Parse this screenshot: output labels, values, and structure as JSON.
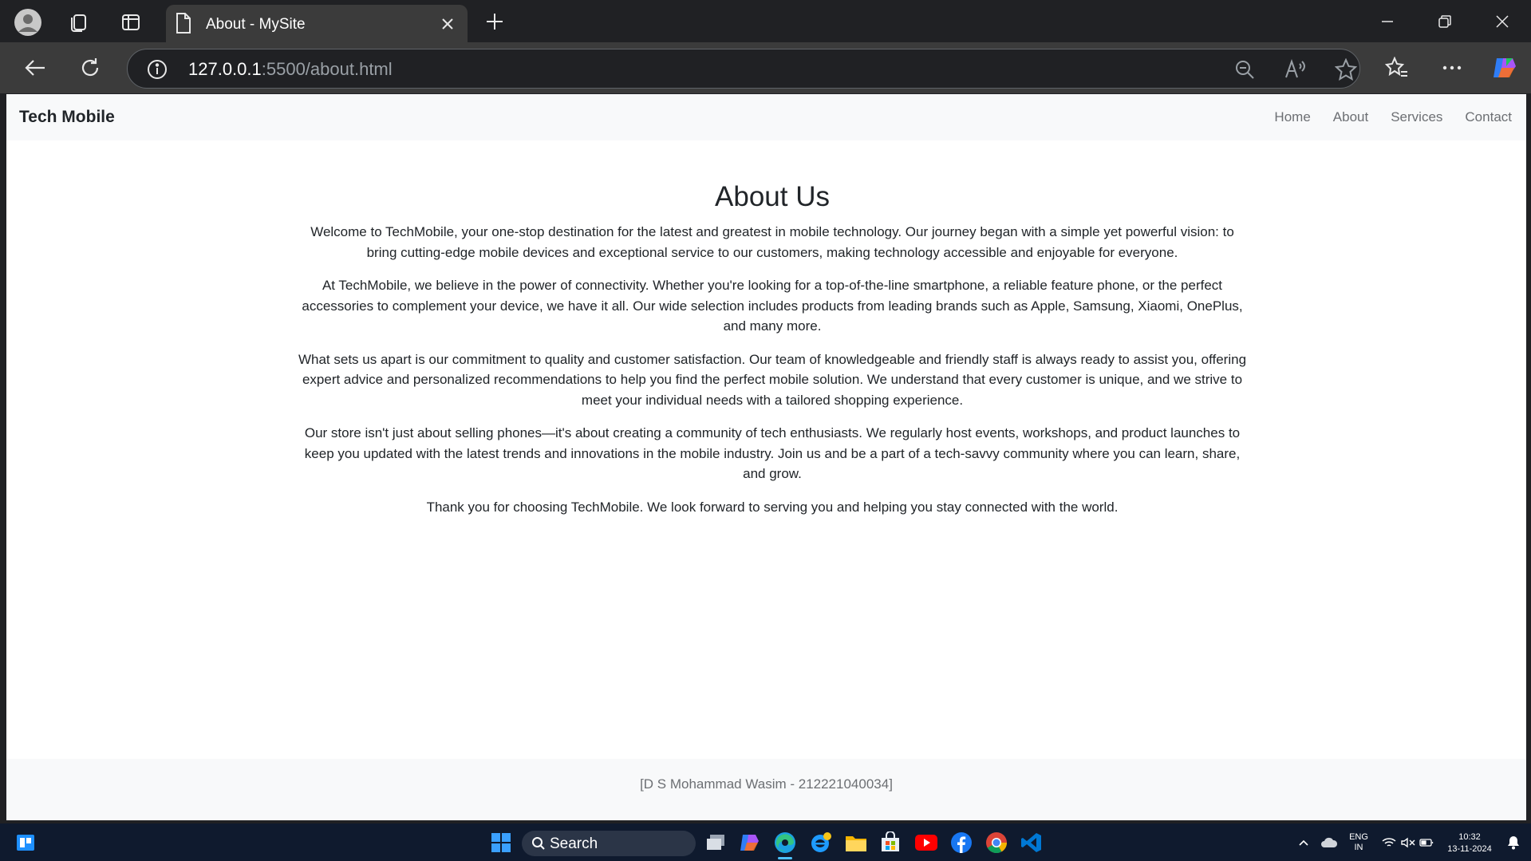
{
  "browser": {
    "tab_title": "About - MySite",
    "url_host": "127.0.0.1",
    "url_rest": ":5500/about.html"
  },
  "site": {
    "brand": "Tech Mobile",
    "nav": [
      "Home",
      "About",
      "Services",
      "Contact"
    ],
    "heading": "About Us",
    "paragraphs": [
      "Welcome to TechMobile, your one-stop destination for the latest and greatest in mobile technology. Our journey began with a simple yet powerful vision: to bring cutting-edge mobile devices and exceptional service to our customers, making technology accessible and enjoyable for everyone.",
      "At TechMobile, we believe in the power of connectivity. Whether you're looking for a top-of-the-line smartphone, a reliable feature phone, or the perfect accessories to complement your device, we have it all. Our wide selection includes products from leading brands such as Apple, Samsung, Xiaomi, OnePlus, and many more.",
      "What sets us apart is our commitment to quality and customer satisfaction. Our team of knowledgeable and friendly staff is always ready to assist you, offering expert advice and personalized recommendations to help you find the perfect mobile solution. We understand that every customer is unique, and we strive to meet your individual needs with a tailored shopping experience.",
      "Our store isn't just about selling phones—it's about creating a community of tech enthusiasts. We regularly host events, workshops, and product launches to keep you updated with the latest trends and innovations in the mobile industry. Join us and be a part of a tech-savvy community where you can learn, share, and grow.",
      "Thank you for choosing TechMobile. We look forward to serving you and helping you stay connected with the world."
    ],
    "footer": "[D S Mohammad Wasim - 212221040034]"
  },
  "taskbar": {
    "search_label": "Search",
    "lang_line1": "ENG",
    "lang_line2": "IN",
    "time": "10:32",
    "date": "13-11-2024"
  },
  "colors": {
    "accent": "#4cc2ff",
    "nav_bg": "#f8f9fa",
    "text": "#212529",
    "muted": "#6c6f73"
  }
}
